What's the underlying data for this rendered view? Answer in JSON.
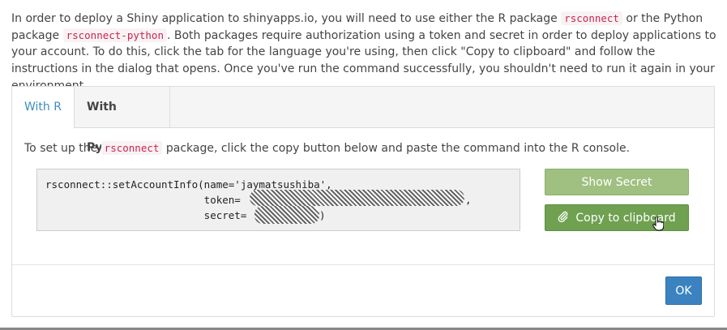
{
  "intro": {
    "t1": "In order to deploy a Shiny application to shinyapps.io, you will need to use either the R package ",
    "code1": "rsconnect",
    "t2": " or the Python package ",
    "code2": "rsconnect-python",
    "t3": ". Both packages require authorization using a token and secret in order to deploy applications to your account. To do this, click the tab for the language you're using, then click \"Copy to clipboard\" and follow the instructions in the dialog that opens. Once you've run the command successfully, you shouldn't need to run it again in your environment."
  },
  "tabs": [
    {
      "label": "With R",
      "active": true
    },
    {
      "label": "With Python",
      "active": false
    }
  ],
  "setup": {
    "t1": "To set up the ",
    "code": "rsconnect",
    "t2": " package, click the copy button below and paste the command into the R console."
  },
  "command": {
    "line1": "rsconnect::setAccountInfo(name='jaymatsushiba',",
    "line2_prefix": "                          token=",
    "line2_suffix": ",",
    "line3_prefix": "                          secret=",
    "line3_suffix": ")"
  },
  "buttons": {
    "show_secret": "Show Secret",
    "copy": "Copy to clipboard",
    "ok": "OK"
  },
  "colors": {
    "tab_active_text": "#3b8dbd",
    "show_secret_bg": "#9fc080",
    "copy_bg": "#6fa150",
    "ok_bg": "#3b83c0",
    "code_text": "#c7254e"
  },
  "icons": {
    "copy": "paperclip-icon",
    "cursor": "hand-pointer-icon"
  }
}
